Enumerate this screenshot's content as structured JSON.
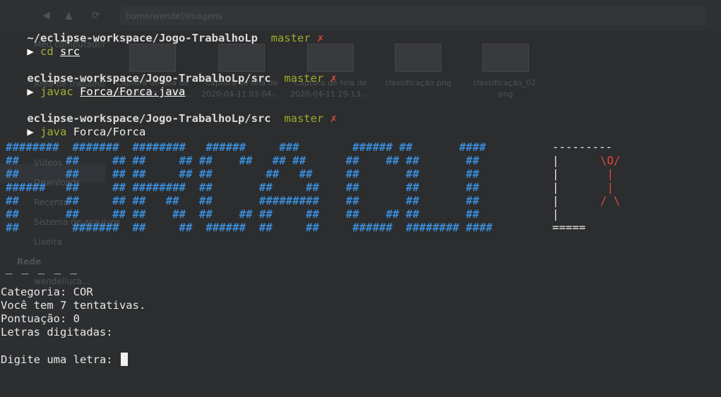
{
  "background_file_manager": {
    "path": "home/wendel/Imagens",
    "sidebar": {
      "items_top": [
        "Meu computador",
        "Área de trabalho"
      ],
      "items": [
        "Vídeos",
        "Downloads",
        "Recente",
        "Sistema de arquivos",
        "Lixeira"
      ],
      "network_heading": "Rede",
      "network_item": "wendelluca..."
    },
    "files": [
      {
        "name_line1": "Captura de tela de",
        "name_line2": "2020-04-03 19-08-..."
      },
      {
        "name_line1": "Captura de tela de",
        "name_line2": "2020-04-11 03-04-..."
      },
      {
        "name_line1": "Captura de tela de",
        "name_line2": "2020-04-11 19-13-..."
      },
      {
        "name_line1": "classificação.png",
        "name_line2": ""
      },
      {
        "name_line1": "classificação_02.",
        "name_line2": "png"
      }
    ]
  },
  "terminal": {
    "prompt1": {
      "path": "~/eclipse-workspace/Jogo-TrabalhoLp",
      "branch": "master",
      "dirty": "✗"
    },
    "cmd1": {
      "arrow": "▶",
      "command": "cd",
      "arg": "src"
    },
    "prompt2": {
      "path": "eclipse-workspace/Jogo-TrabalhoLp/src",
      "branch": "master",
      "dirty": "✗"
    },
    "cmd2": {
      "arrow": "▶",
      "command": "javac",
      "arg": "Forca/Forca.java"
    },
    "prompt3": {
      "path": "eclipse-workspace/Jogo-TrabalhoLp/src",
      "branch": "master",
      "dirty": "✗"
    },
    "cmd3": {
      "arrow": "▶",
      "command": "java",
      "arg": "Forca/Forca"
    },
    "banner": "########  #######  ########   ######     ###        ###### ##       ####\n##       ##     ## ##     ## ##    ##   ## ##      ##    ## ##       ##\n##       ##     ## ##     ## ##        ##   ##     ##       ##       ##\n######   ##     ## ########  ##       ##     ##    ##       ##       ##\n##       ##     ## ##   ##   ##       #########    ##       ##       ##\n##       ##     ## ##    ##  ##    ## ##     ##    ##    ## ##       ##\n##        #######  ##     ##  ######  ##     ##     ######  ######## ####",
    "gallows": "---------\n|\n|\n|\n|\n|\n=====",
    "man": "\\O/\n |\n |\n/ \\",
    "blanks": "_ _ _ _ _",
    "category": "Categoria: COR",
    "attempts": "Você tem 7 tentativas.",
    "score": "Pontuação: 0",
    "typed": "Letras digitadas:",
    "input_prompt": "Digite uma letra: "
  }
}
